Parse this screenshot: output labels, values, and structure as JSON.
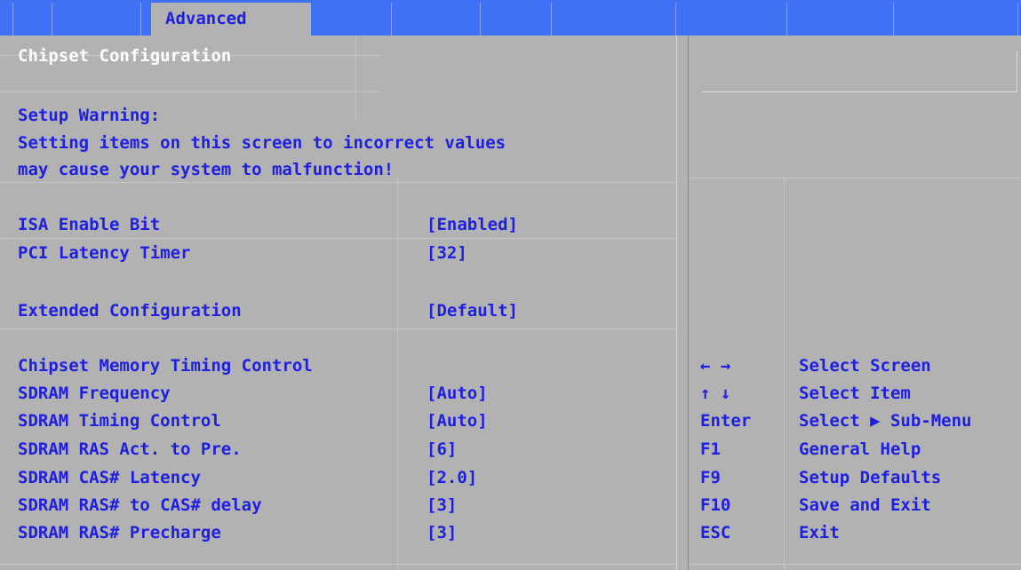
{
  "tabs": {
    "advanced_label": "Advanced"
  },
  "screen": {
    "title": "Chipset Configuration",
    "warning_heading": "Setup Warning:",
    "warning_line1": "Setting items on this screen to incorrect values",
    "warning_line2": "may cause your system to malfunction!"
  },
  "settings": [
    {
      "label": "ISA Enable Bit",
      "value": "[Enabled]"
    },
    {
      "label": "PCI Latency Timer",
      "value": "[32]"
    },
    {
      "label": "Extended Configuration",
      "value": "[Default]"
    },
    {
      "label": "Chipset Memory Timing Control",
      "value": ""
    },
    {
      "label": "SDRAM Frequency",
      "value": "[Auto]"
    },
    {
      "label": "SDRAM Timing Control",
      "value": "[Auto]"
    },
    {
      "label": "SDRAM RAS Act. to Pre.",
      "value": "[6]"
    },
    {
      "label": "SDRAM CAS# Latency",
      "value": "[2.0]"
    },
    {
      "label": "SDRAM RAS# to CAS# delay",
      "value": "[3]"
    },
    {
      "label": "SDRAM RAS# Precharge",
      "value": "[3]"
    }
  ],
  "keys": [
    {
      "key": "← →",
      "action": "Select Screen"
    },
    {
      "key": "↑ ↓",
      "action": "Select Item"
    },
    {
      "key": "Enter",
      "action": "Select ▶ Sub-Menu"
    },
    {
      "key": "F1",
      "action": "General Help"
    },
    {
      "key": "F9",
      "action": "Setup Defaults"
    },
    {
      "key": "F10",
      "action": "Save and Exit"
    },
    {
      "key": "ESC",
      "action": "Exit"
    }
  ],
  "colors": {
    "menubar": "#3f70f5",
    "background": "#b2b2b2",
    "text_blue": "#1f1fe0",
    "text_white": "#ffffff"
  }
}
